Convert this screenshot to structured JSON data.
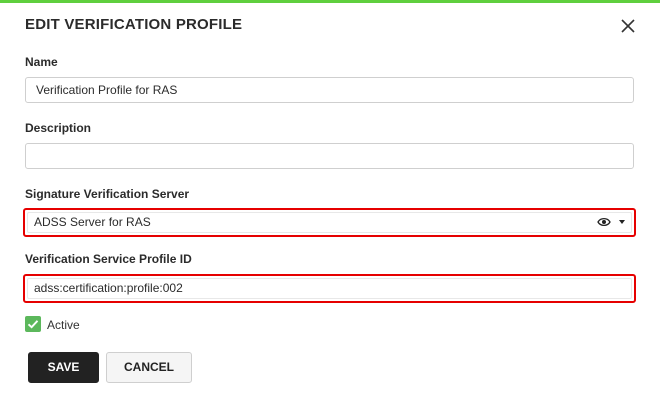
{
  "dialog": {
    "title": "EDIT VERIFICATION PROFILE",
    "accent_color": "#5fcf3e",
    "highlight_color": "#e60000"
  },
  "fields": {
    "name": {
      "label": "Name",
      "value": "Verification Profile for RAS"
    },
    "description": {
      "label": "Description",
      "value": ""
    },
    "server": {
      "label": "Signature Verification Server",
      "value": "ADSS Server for RAS",
      "icons": [
        "eye-icon",
        "chevron-down-icon"
      ]
    },
    "profile_id": {
      "label": "Verification Service Profile ID",
      "value": "adss:certification:profile:002"
    }
  },
  "active": {
    "label": "Active",
    "checked": true,
    "color": "#5cb85c"
  },
  "buttons": {
    "save": "SAVE",
    "cancel": "CANCEL"
  }
}
